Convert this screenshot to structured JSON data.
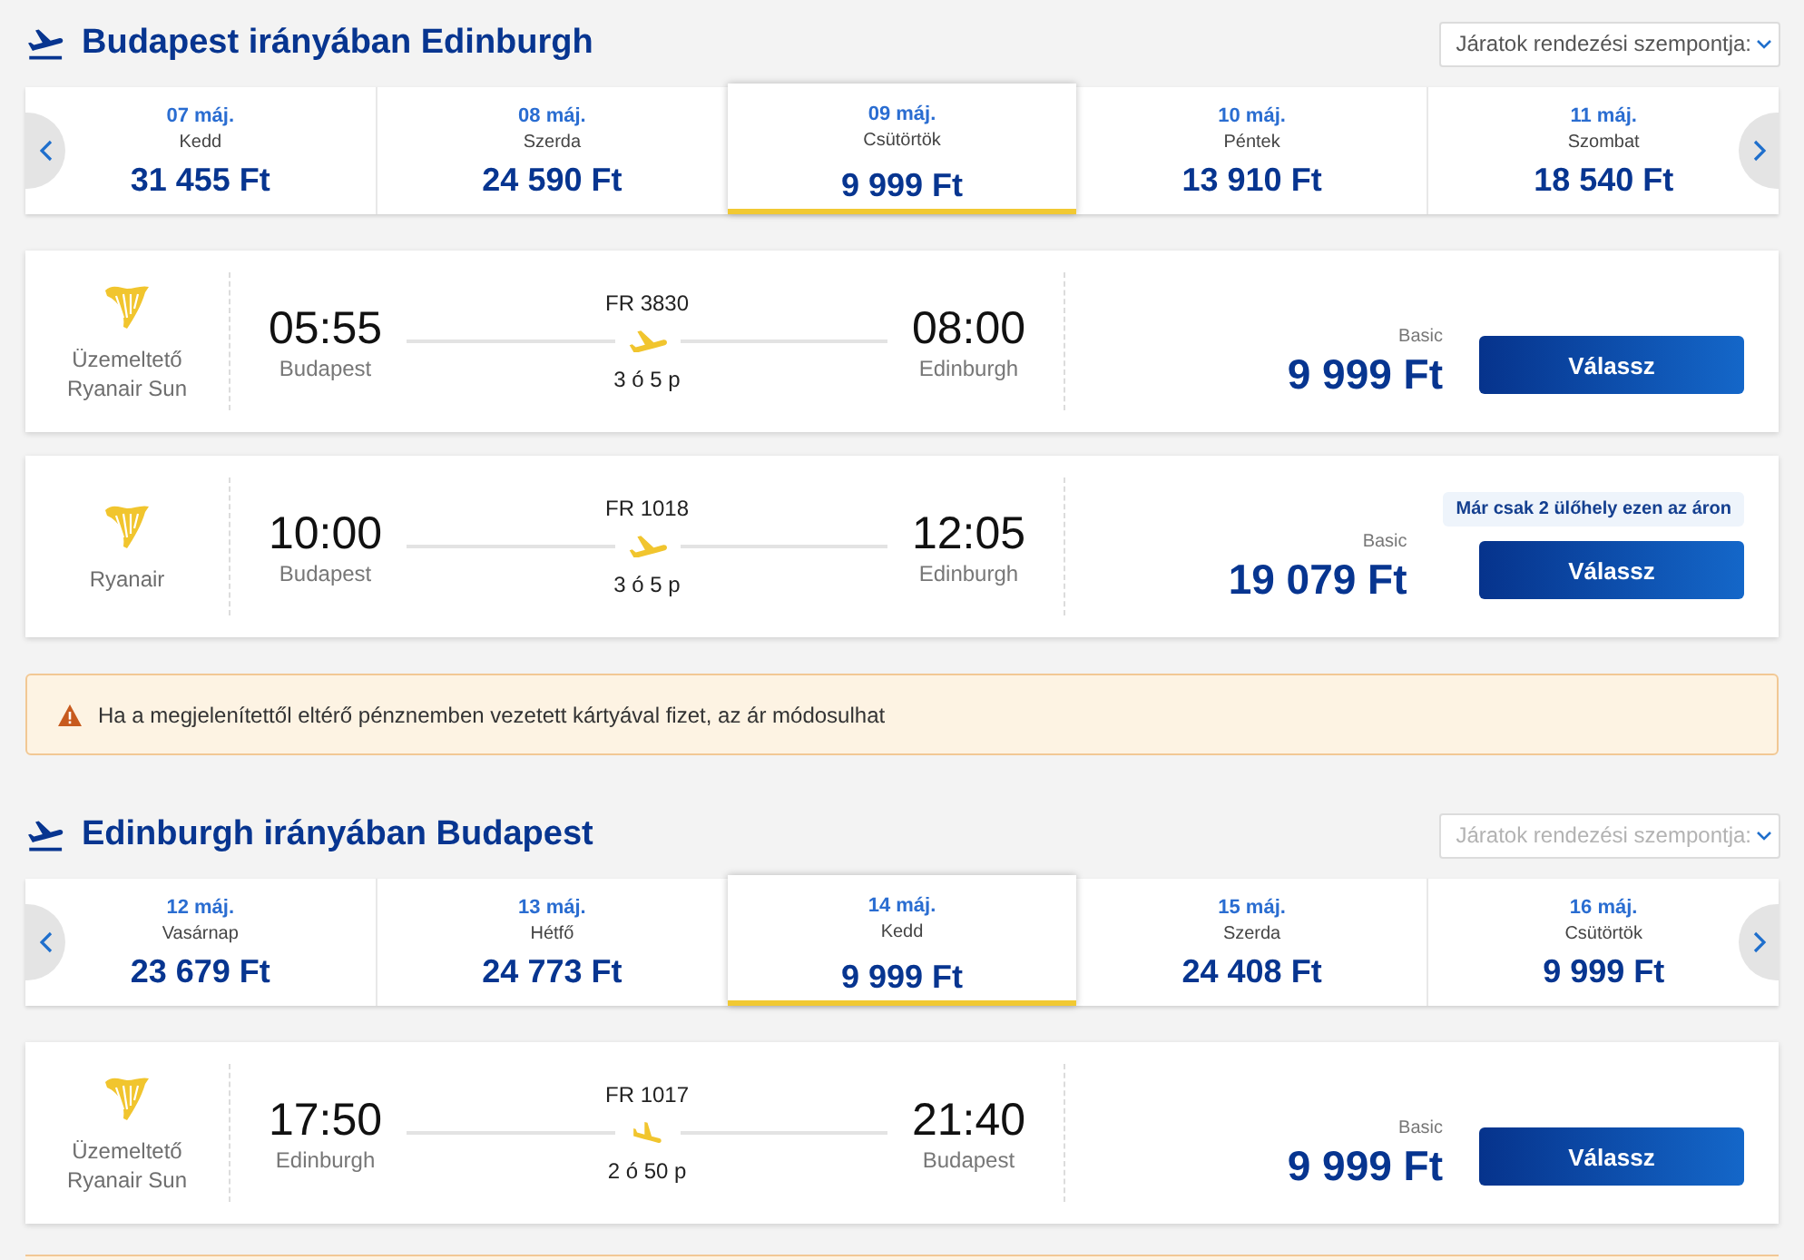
{
  "outbound": {
    "title": "Budapest irányában Edinburgh",
    "sort": {
      "label": "Járatok rendezési szempontja:",
      "disabled": false
    },
    "dates": [
      {
        "date": "07 máj.",
        "weekday": "Kedd",
        "price": "31 455 Ft",
        "selected": false
      },
      {
        "date": "08 máj.",
        "weekday": "Szerda",
        "price": "24 590 Ft",
        "selected": false
      },
      {
        "date": "09 máj.",
        "weekday": "Csütörtök",
        "price": "9 999 Ft",
        "selected": true
      },
      {
        "date": "10 máj.",
        "weekday": "Péntek",
        "price": "13 910 Ft",
        "selected": false
      },
      {
        "date": "11 máj.",
        "weekday": "Szombat",
        "price": "18 540 Ft",
        "selected": false
      }
    ],
    "flights": [
      {
        "operator_label": "Üzemeltető",
        "airline": "Ryanair Sun",
        "departure_time": "05:55",
        "departure_city": "Budapest",
        "flight_number": "FR 3830",
        "duration": "3 ó 5 p",
        "arrival_time": "08:00",
        "arrival_city": "Edinburgh",
        "fare": "Basic",
        "price": "9 999 Ft",
        "button": "Válassz"
      },
      {
        "airline": "Ryanair",
        "departure_time": "10:00",
        "departure_city": "Budapest",
        "flight_number": "FR 1018",
        "duration": "3 ó 5 p",
        "arrival_time": "12:05",
        "arrival_city": "Edinburgh",
        "badge": "Már csak 2 ülőhely ezen az áron",
        "fare": "Basic",
        "price": "19 079 Ft",
        "button": "Válassz"
      }
    ]
  },
  "payment_notice": {
    "text": "Ha a megjelenítettől eltérő pénznemben vezetett kártyával fizet, az ár módosulhat"
  },
  "return": {
    "title": "Edinburgh irányában Budapest",
    "sort": {
      "label": "Járatok rendezési szempontja:",
      "disabled": true
    },
    "dates": [
      {
        "date": "12 máj.",
        "weekday": "Vasárnap",
        "price": "23 679 Ft",
        "selected": false
      },
      {
        "date": "13 máj.",
        "weekday": "Hétfő",
        "price": "24 773 Ft",
        "selected": false
      },
      {
        "date": "14 máj.",
        "weekday": "Kedd",
        "price": "9 999 Ft",
        "selected": true
      },
      {
        "date": "15 máj.",
        "weekday": "Szerda",
        "price": "24 408 Ft",
        "selected": false
      },
      {
        "date": "16 máj.",
        "weekday": "Csütörtök",
        "price": "9 999 Ft",
        "selected": false
      }
    ],
    "flights": [
      {
        "operator_label": "Üzemeltető",
        "airline": "Ryanair Sun",
        "departure_time": "17:50",
        "departure_city": "Edinburgh",
        "flight_number": "FR 1017",
        "duration": "2 ó 50 p",
        "arrival_time": "21:40",
        "arrival_city": "Budapest",
        "fare": "Basic",
        "price": "9 999 Ft",
        "button": "Válassz"
      }
    ]
  }
}
